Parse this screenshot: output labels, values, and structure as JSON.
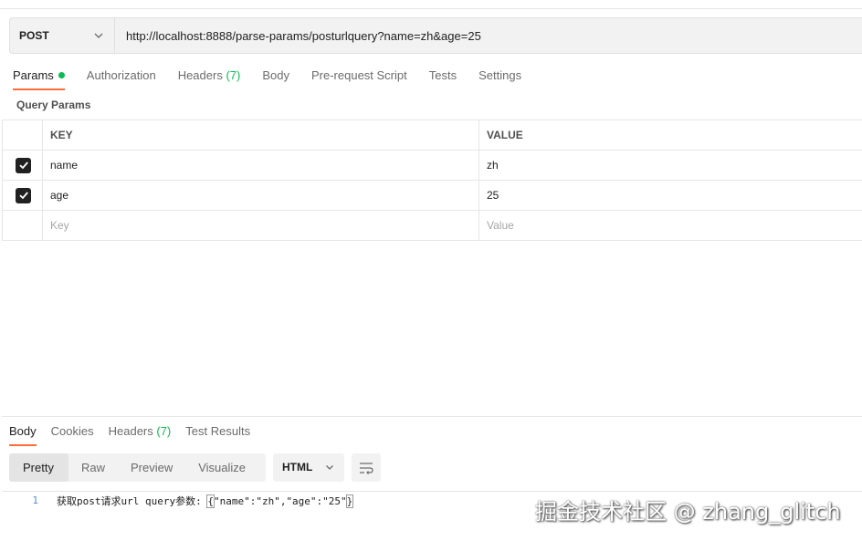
{
  "request": {
    "method": "POST",
    "url": "http://localhost:8888/parse-params/posturlquery?name=zh&age=25"
  },
  "request_tabs": [
    {
      "label": "Params",
      "active": true,
      "dot": true
    },
    {
      "label": "Authorization"
    },
    {
      "label": "Headers",
      "count": "(7)"
    },
    {
      "label": "Body"
    },
    {
      "label": "Pre-request Script"
    },
    {
      "label": "Tests"
    },
    {
      "label": "Settings"
    }
  ],
  "query_params": {
    "title": "Query Params",
    "headers": {
      "key": "KEY",
      "value": "VALUE"
    },
    "rows": [
      {
        "key": "name",
        "value": "zh",
        "checked": true
      },
      {
        "key": "age",
        "value": "25",
        "checked": true
      }
    ],
    "placeholder": {
      "key": "Key",
      "value": "Value"
    }
  },
  "response_tabs": [
    {
      "label": "Body",
      "active": true
    },
    {
      "label": "Cookies"
    },
    {
      "label": "Headers",
      "count": "(7)"
    },
    {
      "label": "Test Results"
    }
  ],
  "view_modes": [
    "Pretty",
    "Raw",
    "Preview",
    "Visualize"
  ],
  "active_view": "Pretty",
  "format": "HTML",
  "response_body": {
    "line_number": "1",
    "prefix": "获取post请求url query参数: ",
    "open_brace": "{",
    "inner": "\"name\":\"zh\",\"age\":\"25\"",
    "close_brace": "}"
  },
  "watermark": "掘金技术社区 @ zhang_glitch",
  "colors": {
    "accent": "#ff6c37",
    "success": "#0cbb52",
    "line_number": "#4f8fd6"
  },
  "icons": {
    "method_dropdown": "chevron-down-icon",
    "format_dropdown": "chevron-down-icon",
    "wrap": "wrap-lines-icon",
    "check": "check-icon"
  }
}
